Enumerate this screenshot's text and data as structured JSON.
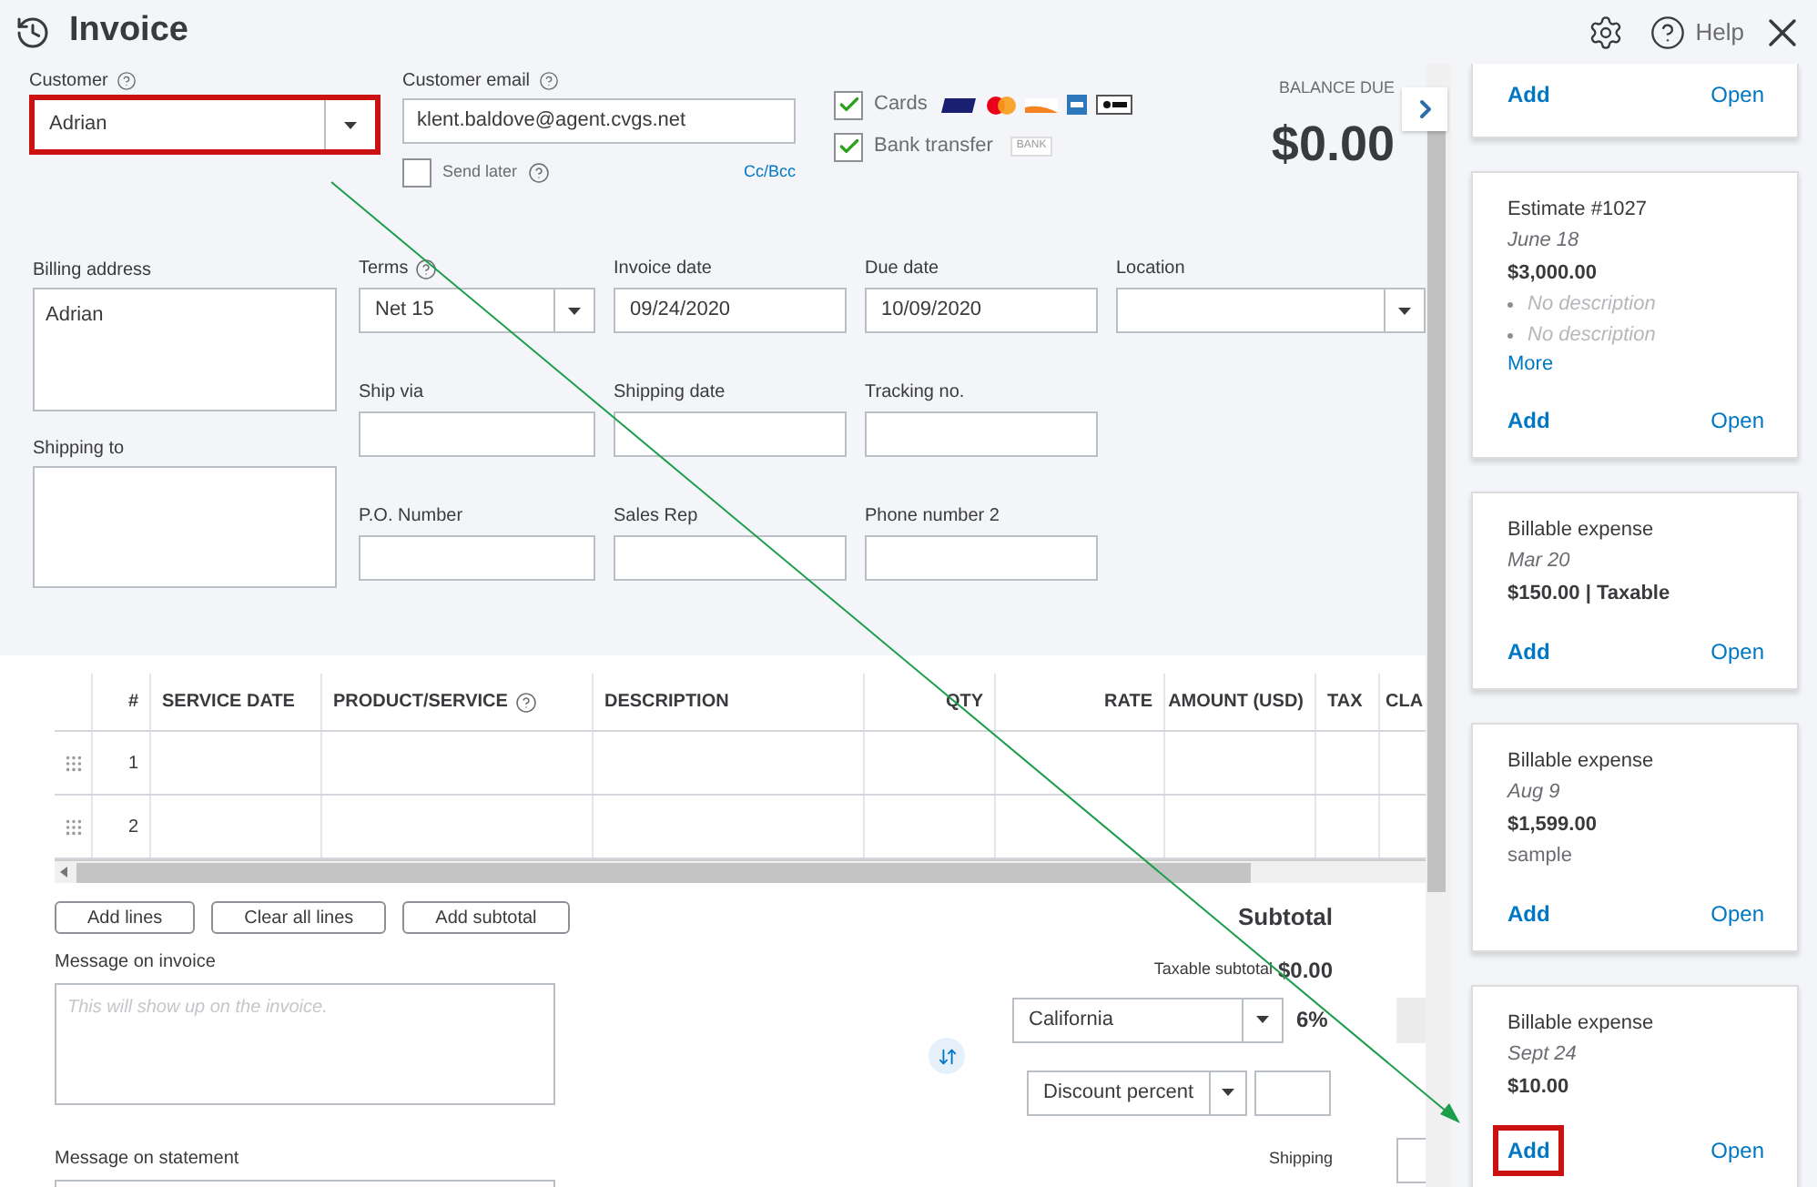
{
  "header": {
    "title": "Invoice",
    "help": "Help"
  },
  "customer": {
    "label": "Customer",
    "value": "Adrian",
    "highlighted": true
  },
  "customer_email": {
    "label": "Customer email",
    "value": "klent.baldove@agent.cvgs.net",
    "send_later": {
      "label": "Send later",
      "checked": false
    },
    "cc_bcc": "Cc/Bcc"
  },
  "payment_options": [
    {
      "kind": "cards",
      "label": "Cards",
      "checked": true
    },
    {
      "kind": "bank",
      "label": "Bank transfer",
      "checked": true,
      "badge": "BANK"
    }
  ],
  "balance": {
    "label": "BALANCE DUE",
    "amount": "$0.00"
  },
  "billing_address": {
    "label": "Billing address",
    "value": "Adrian"
  },
  "shipping_to": {
    "label": "Shipping to"
  },
  "detail_rows": [
    [
      {
        "label": "Terms",
        "kind": "select",
        "value": "Net 15",
        "help": true
      },
      {
        "label": "Invoice date",
        "kind": "text",
        "value": "09/24/2020",
        "help": false
      },
      {
        "label": "Due date",
        "kind": "text",
        "value": "10/09/2020",
        "help": false
      },
      {
        "label": "Location",
        "kind": "select",
        "help": false
      }
    ],
    [
      {
        "label": "Ship via",
        "kind": "text",
        "help": false
      },
      {
        "label": "Shipping date",
        "kind": "text",
        "help": false
      },
      {
        "label": "Tracking no.",
        "kind": "text",
        "help": false
      }
    ],
    [
      {
        "label": "P.O. Number",
        "kind": "text",
        "help": false
      },
      {
        "label": "Sales Rep",
        "kind": "text",
        "help": false
      },
      {
        "label": "Phone number 2",
        "kind": "text",
        "help": false
      }
    ]
  ],
  "table": {
    "columns": [
      {
        "label": "#",
        "kind": "numeric",
        "help": false
      },
      {
        "label": "SERVICE DATE",
        "kind": "text",
        "help": false
      },
      {
        "label": "PRODUCT/SERVICE",
        "kind": "text",
        "help": true
      },
      {
        "label": "DESCRIPTION",
        "kind": "text",
        "help": false
      },
      {
        "label": "QTY",
        "kind": "numeric",
        "help": false
      },
      {
        "label": "RATE",
        "kind": "numeric",
        "help": false
      },
      {
        "label": "AMOUNT (USD)",
        "kind": "numeric",
        "help": false
      },
      {
        "label": "TAX",
        "kind": "text",
        "help": false
      },
      {
        "label": "CLA",
        "kind": "text",
        "help": false
      }
    ],
    "rows": [
      {
        "number": "1"
      },
      {
        "number": "2"
      }
    ]
  },
  "line_buttons": [
    "Add lines",
    "Clear all lines",
    "Add subtotal"
  ],
  "message_on_invoice": {
    "label": "Message on invoice",
    "placeholder": "This will show up on the invoice."
  },
  "message_on_statement": {
    "label": "Message on statement"
  },
  "summary": {
    "subtotal": "Subtotal",
    "taxable_subtotal": {
      "label": "Taxable subtotal",
      "value": "$0.00"
    },
    "tax": {
      "value": "California",
      "rate": "6%"
    },
    "discount": {
      "value": "Discount percent"
    },
    "shipping": {
      "label": "Shipping"
    }
  },
  "cards": [
    {
      "add": "Add",
      "open": "Open",
      "highlighted": false
    },
    {
      "title": "Estimate #1027",
      "date": "June 18",
      "amount": "$3,000.00",
      "items": [
        "No description",
        "No description"
      ],
      "more": "More",
      "add": "Add",
      "open": "Open",
      "highlighted": false
    },
    {
      "title": "Billable expense",
      "date": "Mar 20",
      "amount": "$150.00 | **Taxable**",
      "add": "Add",
      "open": "Open",
      "highlighted": false
    },
    {
      "title": "Billable expense",
      "date": "Aug 9",
      "amount": "$1,599.00",
      "note": "sample",
      "add": "Add",
      "open": "Open",
      "highlighted": false
    },
    {
      "title": "Billable expense",
      "date": "Sept 24",
      "amount": "$10.00",
      "add": "Add",
      "open": "Open",
      "highlighted": true
    }
  ]
}
